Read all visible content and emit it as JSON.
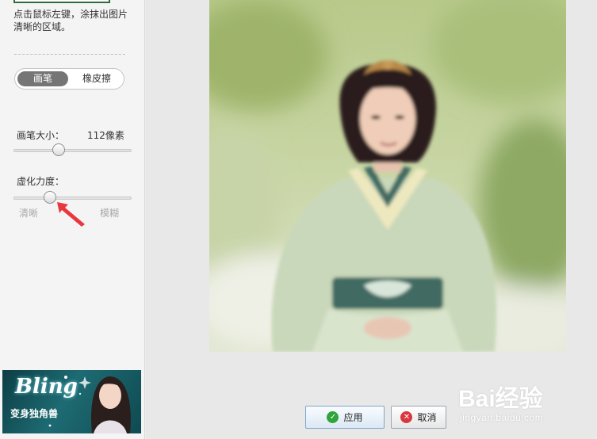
{
  "sidebar": {
    "hint_text": "点击鼠标左键，涂抹出图片清晰的区域。",
    "mode": {
      "brush_label": "画笔",
      "eraser_label": "橡皮擦",
      "selected": "画笔"
    },
    "brush_size": {
      "label": "画笔大小：",
      "value_text": "112像素",
      "level": 0.38
    },
    "blur_strength": {
      "label": "虚化力度：",
      "level": 0.31,
      "min_label": "清晰",
      "max_label": "模糊"
    }
  },
  "ad": {
    "title": "Bling",
    "subtitle": "变身独角兽"
  },
  "footer": {
    "apply_label": "应用",
    "cancel_label": "取消"
  },
  "watermark": {
    "logo": "Bai经验",
    "url": "jingyan.baidu.com"
  },
  "icons": {
    "apply": "check-icon",
    "cancel": "close-icon",
    "annotation": "red-arrow-icon"
  },
  "colors": {
    "annotation_arrow": "#e8383d",
    "apply_icon": "#2ea43a",
    "cancel_icon": "#d9363e",
    "brush_selected": "#757575"
  }
}
